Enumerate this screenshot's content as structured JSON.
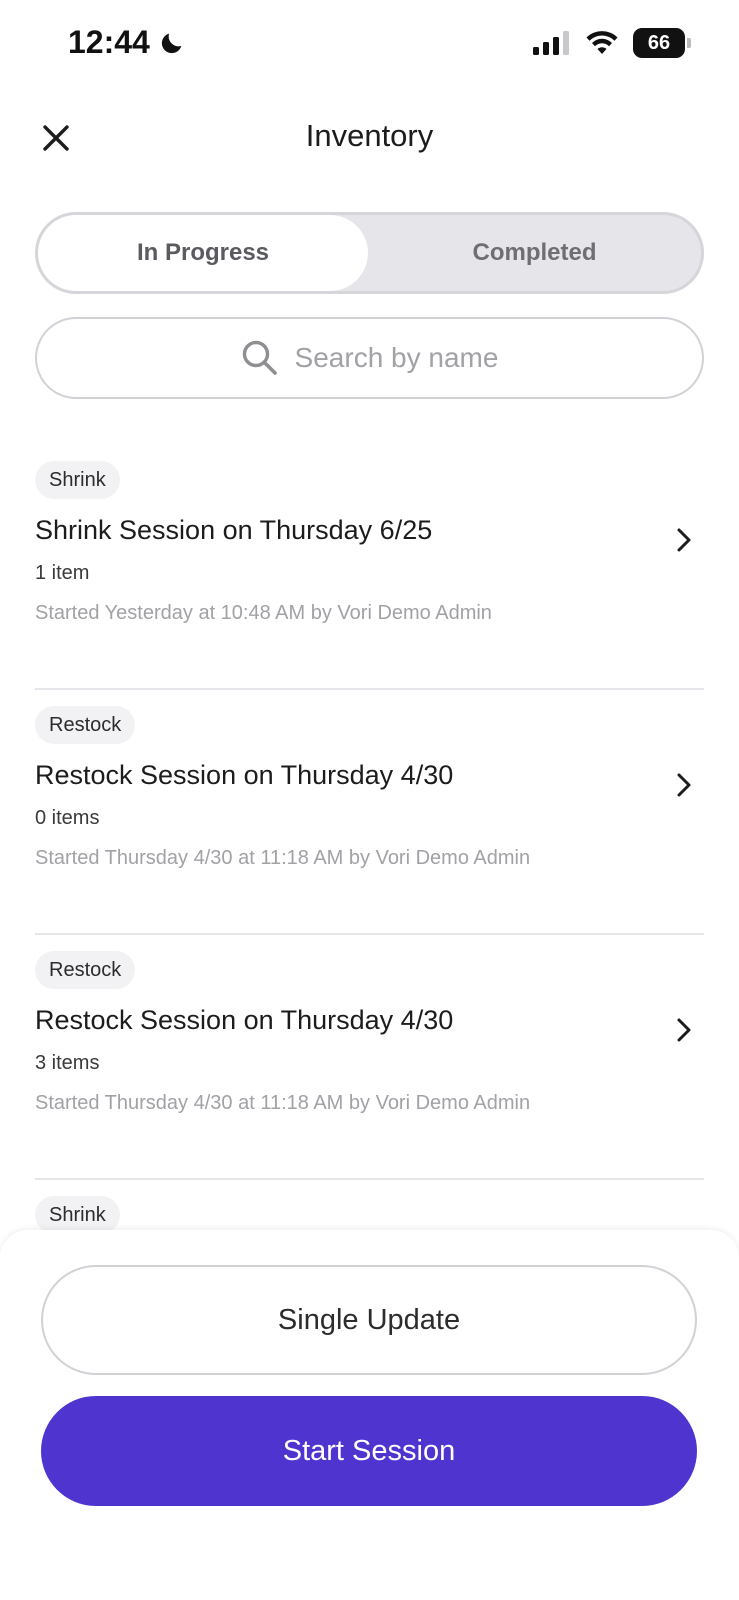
{
  "status_bar": {
    "time": "12:44",
    "battery": "66"
  },
  "header": {
    "title": "Inventory"
  },
  "tabs": [
    {
      "label": "In Progress",
      "selected": true
    },
    {
      "label": "Completed",
      "selected": false
    }
  ],
  "search": {
    "placeholder": "Search by name"
  },
  "sessions": [
    {
      "tag": "Shrink",
      "title": "Shrink Session on Thursday 6/25",
      "count": "1 item",
      "meta": "Started Yesterday at 10:48 AM by Vori Demo Admin"
    },
    {
      "tag": "Restock",
      "title": "Restock Session on Thursday 4/30",
      "count": "0 items",
      "meta": "Started Thursday 4/30 at 11:18 AM by Vori Demo Admin"
    },
    {
      "tag": "Restock",
      "title": "Restock Session on Thursday 4/30",
      "count": "3 items",
      "meta": "Started Thursday 4/30 at 11:18 AM by Vori Demo Admin"
    },
    {
      "tag": "Shrink"
    }
  ],
  "actions": {
    "single_update": "Single Update",
    "start_session": "Start Session"
  },
  "colors": {
    "primary": "#5034D0"
  }
}
